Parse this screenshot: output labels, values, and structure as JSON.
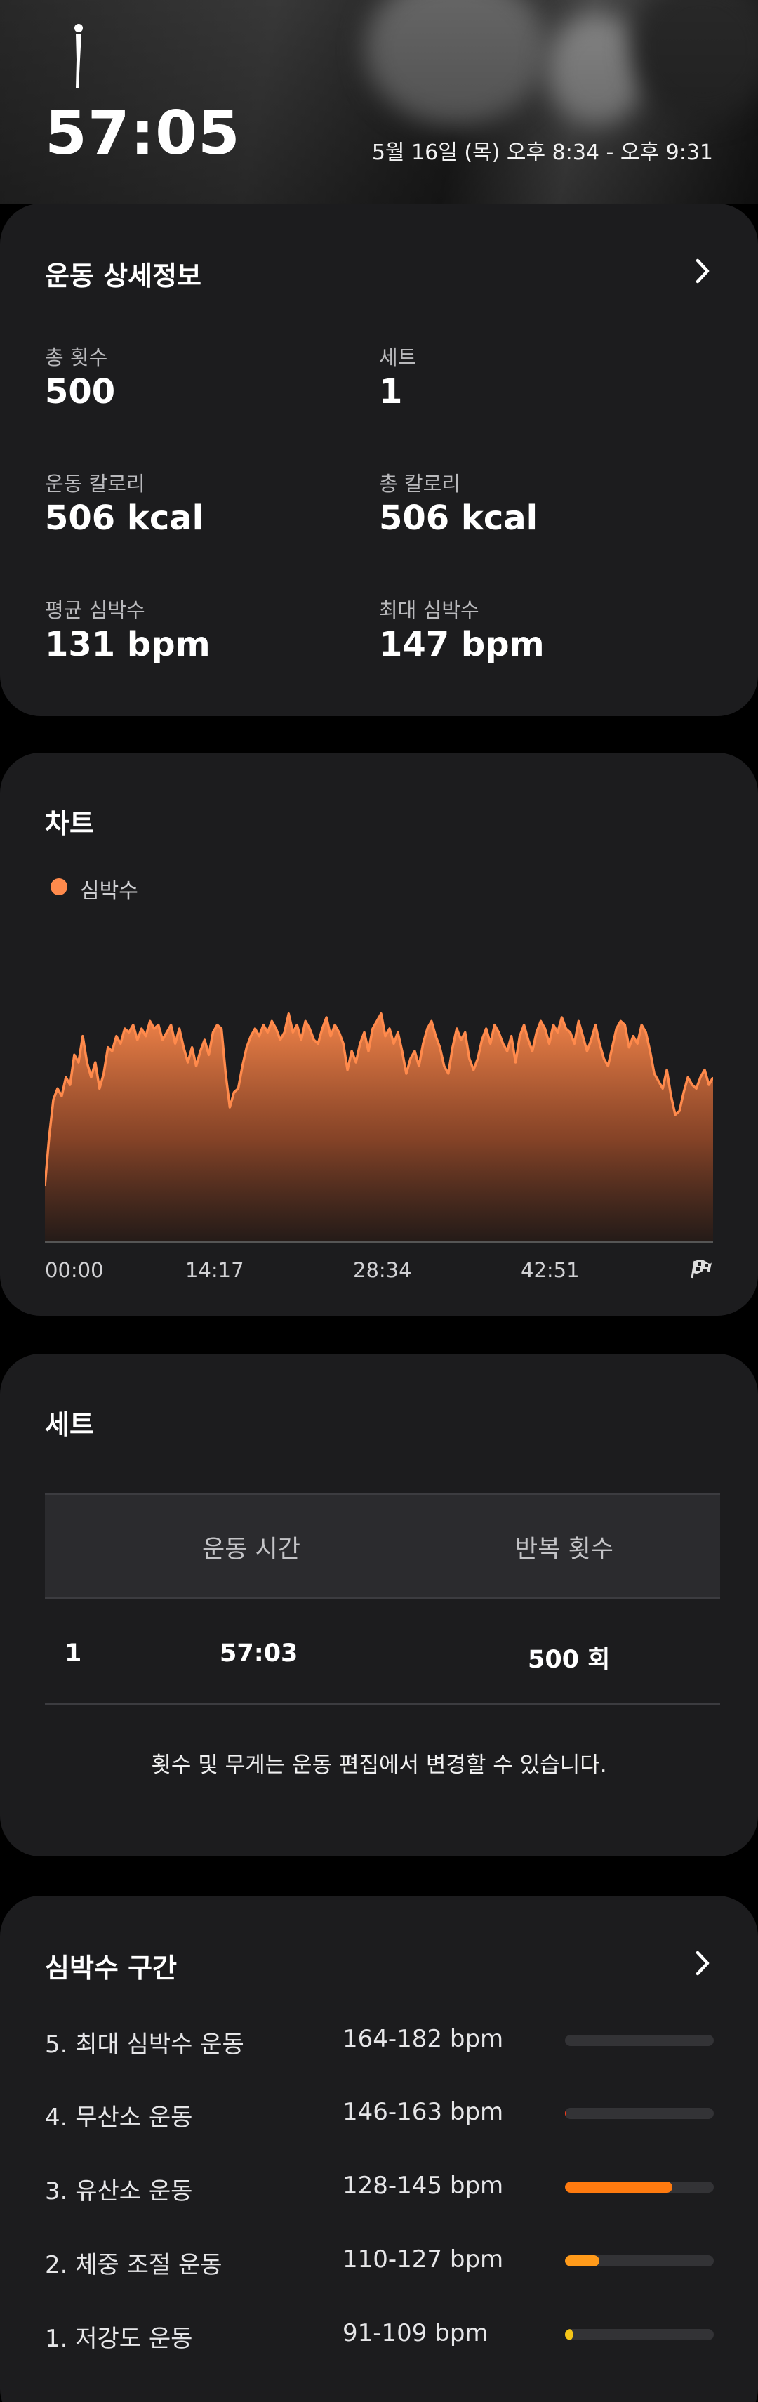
{
  "header": {
    "duration": "57:05",
    "datetime": "5월 16일 (목) 오후 8:34 - 오후 9:31"
  },
  "details": {
    "title": "운동 상세정보",
    "stats": [
      {
        "label": "총 횟수",
        "value": "500"
      },
      {
        "label": "세트",
        "value": "1"
      },
      {
        "label": "운동 칼로리",
        "value": "506 kcal"
      },
      {
        "label": "총 칼로리",
        "value": "506 kcal"
      },
      {
        "label": "평균 심박수",
        "value": "131 bpm"
      },
      {
        "label": "최대 심박수",
        "value": "147 bpm"
      }
    ]
  },
  "chart_section": {
    "title": "차트",
    "legend": "심박수",
    "ticks": [
      "00:00",
      "14:17",
      "28:34",
      "42:51"
    ],
    "accent": "#ff8a4c"
  },
  "chart_data": {
    "type": "area",
    "series": [
      {
        "name": "심박수",
        "values": [
          95,
          108,
          118,
          121,
          119,
          124,
          122,
          130,
          128,
          135,
          128,
          124,
          128,
          121,
          125,
          132,
          131,
          135,
          133,
          137,
          136,
          138,
          134,
          137,
          135,
          139,
          137,
          138,
          134,
          136,
          138,
          133,
          137,
          132,
          128,
          132,
          127,
          131,
          134,
          130,
          136,
          138,
          137,
          125,
          116,
          120,
          121,
          127,
          132,
          135,
          137,
          135,
          138,
          136,
          139,
          137,
          134,
          136,
          141,
          136,
          138,
          134,
          139,
          137,
          134,
          133,
          137,
          140,
          135,
          138,
          136,
          133,
          126,
          131,
          128,
          133,
          136,
          131,
          137,
          139,
          141,
          135,
          137,
          133,
          136,
          131,
          125,
          129,
          131,
          127,
          133,
          137,
          139,
          135,
          132,
          127,
          125,
          132,
          137,
          134,
          136,
          129,
          126,
          129,
          134,
          137,
          133,
          138,
          136,
          133,
          131,
          135,
          128,
          135,
          138,
          134,
          131,
          136,
          139,
          137,
          133,
          138,
          136,
          140,
          137,
          136,
          133,
          139,
          135,
          131,
          134,
          138,
          133,
          129,
          127,
          132,
          137,
          139,
          138,
          132,
          135,
          133,
          138,
          136,
          131,
          125,
          123,
          121,
          126,
          119,
          114,
          115,
          120,
          124,
          122,
          121,
          124,
          126,
          122,
          124
        ]
      }
    ],
    "xlabel": "",
    "ylabel": "",
    "grid": false
  },
  "sets": {
    "title": "세트",
    "columns": [
      "운동 시간",
      "반복 횟수"
    ],
    "rows": [
      {
        "index": "1",
        "time": "57:03",
        "reps": "500 회"
      }
    ],
    "note": "횟수 및 무게는 운동 편집에서 변경할 수 있습니다."
  },
  "zones": {
    "title": "심박수 구간",
    "items": [
      {
        "name": "5. 최대 심박수 운동",
        "range": "164-182 bpm",
        "fraction": 0.0,
        "color": "#ff6b1a"
      },
      {
        "name": "4. 무산소 운동",
        "range": "146-163 bpm",
        "fraction": 0.01,
        "color": "#ff3b1a"
      },
      {
        "name": "3. 유산소 운동",
        "range": "128-145 bpm",
        "fraction": 0.72,
        "color": "#ff7a0f"
      },
      {
        "name": "2. 체중 조절 운동",
        "range": "110-127 bpm",
        "fraction": 0.23,
        "color": "#ff9a1a"
      },
      {
        "name": "1. 저강도 운동",
        "range": "91-109 bpm",
        "fraction": 0.05,
        "color": "#f5c518"
      }
    ]
  }
}
